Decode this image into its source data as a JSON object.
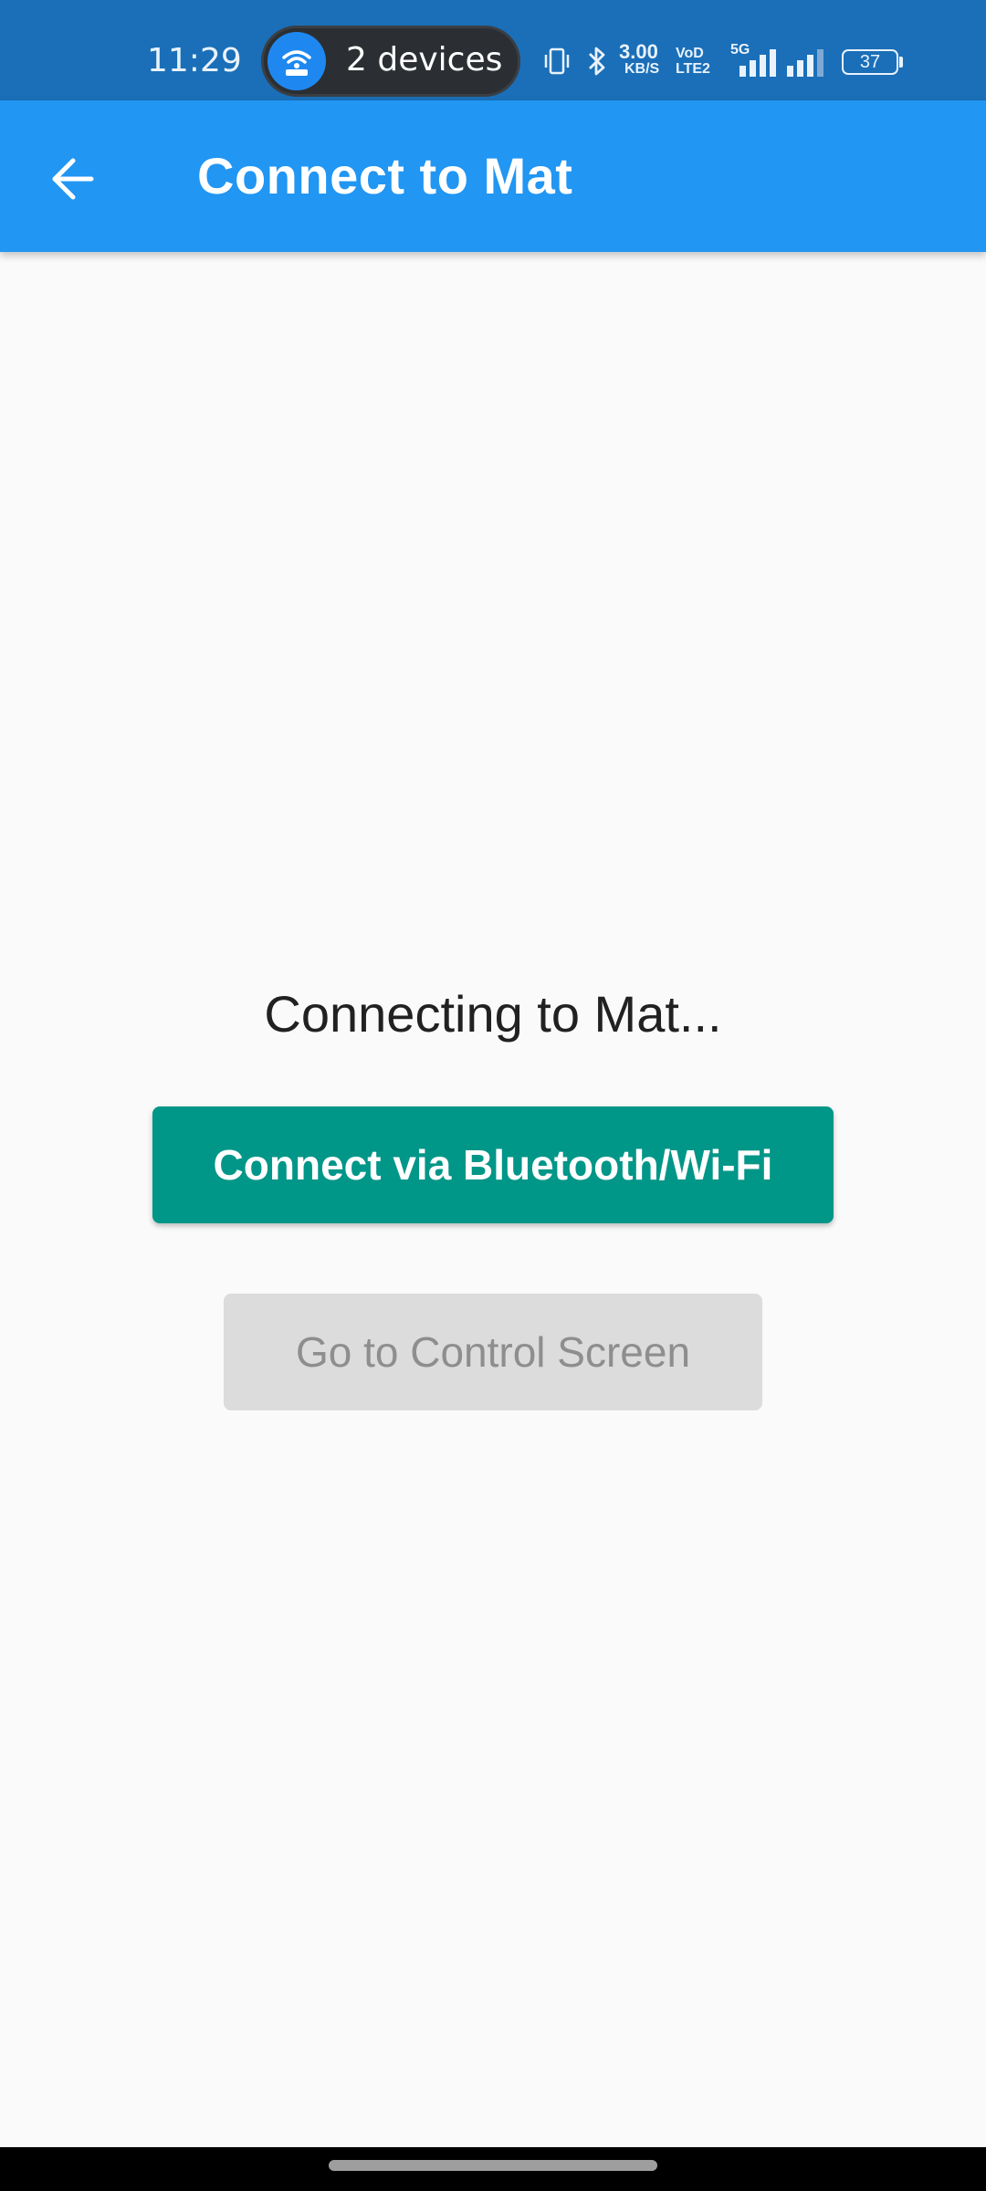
{
  "status_bar": {
    "time": "11:29",
    "hotspot_label": "2 devices",
    "net_speed_value": "3.00",
    "net_speed_unit": "KB/S",
    "volte_top": "VoD",
    "volte_bottom": "LTE2",
    "network_type": "5G",
    "battery_level": "37",
    "icons": [
      "wifi-hotspot-icon",
      "vibrate-icon",
      "bluetooth-icon",
      "signal-5g-icon",
      "signal-icon",
      "battery-icon"
    ]
  },
  "app_bar": {
    "title": "Connect to Mat",
    "back_icon": "arrow-left-icon",
    "color": "#2196f3"
  },
  "main": {
    "status_text": "Connecting to Mat...",
    "connect_button_label": "Connect via Bluetooth/Wi-Fi",
    "control_button_label": "Go to Control Screen",
    "connect_button_color": "#009688",
    "control_button_enabled": false
  }
}
